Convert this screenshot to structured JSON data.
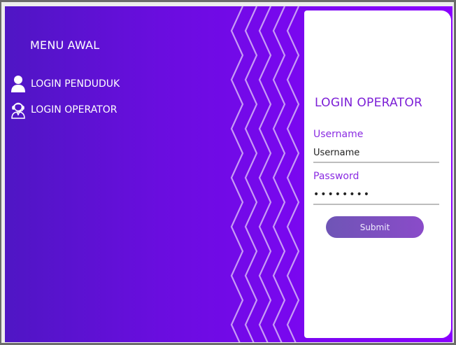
{
  "sidebar": {
    "title": "MENU AWAL",
    "items": [
      {
        "label": "LOGIN PENDUDUK",
        "icon": "user-icon"
      },
      {
        "label": "LOGIN OPERATOR",
        "icon": "operator-headset-icon"
      }
    ]
  },
  "login_form": {
    "title": "LOGIN OPERATOR",
    "username_label": "Username",
    "username_placeholder": "Username",
    "password_label": "Password",
    "password_value": "••••••••",
    "submit_label": "Submit"
  },
  "colors": {
    "background_gradient_start": "#4f16c4",
    "background_gradient_end": "#8a00ff",
    "accent_text": "#7c1fd6",
    "button_gradient_start": "#6f55b6",
    "button_gradient_end": "#8a4bc9"
  }
}
